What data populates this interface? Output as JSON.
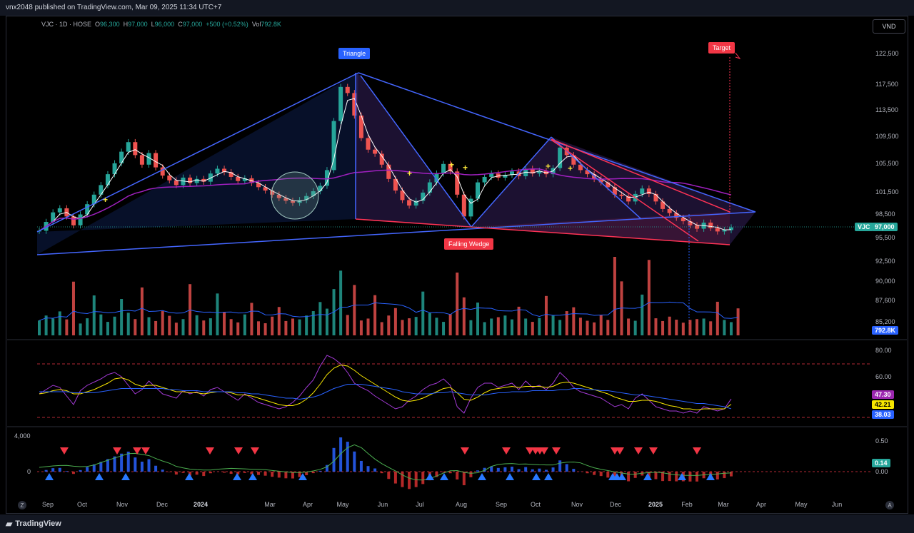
{
  "header": {
    "published": "vnx2048 published on TradingView.com, Mar 09, 2025 11:34 UTC+7"
  },
  "legend": {
    "symbol": "VJC · 1D · HOSE",
    "o_label": "O",
    "o": "96,300",
    "h_label": "H",
    "h": "97,000",
    "l_label": "L",
    "l": "96,000",
    "c_label": "C",
    "c": "97,000",
    "chg": "+500 (+0.52%)",
    "vol_label": "Vol",
    "vol": "792.8K"
  },
  "currency": "VND",
  "footer": {
    "logo": "TradingView"
  },
  "buttons": {
    "z": "Z",
    "a": "A"
  },
  "colors": {
    "up": "#26a69a",
    "down": "#ef5350",
    "pattern": "#4466ff",
    "wedge": "#ff3355",
    "ma": "#a020c0",
    "rsi": "#a33ad6",
    "label_blue": "#2962ff",
    "label_red": "#f23645"
  },
  "chart_data": [
    {
      "type": "candlestick",
      "symbol": "VJC",
      "interval": "1D",
      "exchange": "HOSE",
      "x_ticks": [
        "Sep",
        "Oct",
        "Nov",
        "Dec",
        "2024",
        "Mar",
        "Apr",
        "May",
        "Jun",
        "Jul",
        "Aug",
        "Sep",
        "Oct",
        "Nov",
        "Dec",
        "2025",
        "Feb",
        "Mar",
        "Apr",
        "May",
        "Jun"
      ],
      "y_ticks": [
        "122,500",
        "117,500",
        "113,500",
        "109,500",
        "105,500",
        "101,500",
        "98,500",
        "95,500",
        "92,500",
        "90,000",
        "87,600",
        "85,200"
      ],
      "last_price": "97,000",
      "price_label": "VJC",
      "annotations": [
        "Triangle",
        "Falling Wedge",
        "Target"
      ],
      "close": [
        96500,
        97800,
        99200,
        99800,
        98600,
        97300,
        98900,
        100400,
        101800,
        103200,
        104800,
        106400,
        108100,
        109500,
        107600,
        106200,
        107900,
        105800,
        104600,
        103900,
        103200,
        104300,
        103500,
        104100,
        103700,
        104900,
        105600,
        105100,
        104400,
        103800,
        104200,
        103500,
        102900,
        102400,
        101800,
        101300,
        100900,
        100600,
        101000,
        101600,
        102300,
        103100,
        105400,
        112600,
        117600,
        116700,
        113400,
        110100,
        108400,
        107800,
        106200,
        104100,
        102400,
        101000,
        100200,
        100900,
        102100,
        103600,
        104900,
        106300,
        105200,
        101800,
        98600,
        101200,
        103600,
        104400,
        104900,
        104300,
        104700,
        105200,
        104500,
        105600,
        104900,
        105300,
        104800,
        105700,
        108700,
        107600,
        106200,
        105400,
        104800,
        104100,
        103600,
        102900,
        101800,
        101600,
        100800,
        101900,
        102700,
        101900,
        100800,
        99700,
        99100,
        98400,
        97900,
        97300,
        96800,
        97700,
        96900,
        96400,
        96600,
        97000
      ],
      "volume_k": [
        540,
        720,
        610,
        870,
        580,
        1950,
        430,
        620,
        1450,
        760,
        490,
        680,
        1320,
        820,
        590,
        1740,
        660,
        520,
        880,
        710,
        460,
        590,
        1860,
        730,
        540,
        620,
        1520,
        840,
        590,
        470,
        760,
        1180,
        510,
        440,
        680,
        1030,
        520,
        610,
        580,
        720,
        880,
        1210,
        970,
        1680,
        2350,
        740,
        1830,
        540,
        610,
        1460,
        480,
        720,
        990,
        560,
        620,
        670,
        1590,
        810,
        640,
        490,
        770,
        2280,
        1380,
        550,
        1190,
        480,
        610,
        660,
        720,
        580,
        1040,
        610,
        490,
        630,
        1430,
        720,
        560,
        880,
        1020,
        640,
        530,
        470,
        740,
        560,
        2850,
        1960,
        610,
        530,
        1480,
        2740,
        620,
        520,
        680,
        570,
        460,
        560,
        590,
        610,
        510,
        1220,
        560,
        480,
        980
      ]
    },
    {
      "type": "line",
      "name": "RSI",
      "y_ticks": [
        "80.00",
        "60.00"
      ],
      "last_values": [
        "47.30",
        "42.21",
        "38.03"
      ],
      "rsi": [
        52,
        56,
        60,
        58,
        50,
        42,
        55,
        60,
        63,
        66,
        70,
        72,
        68,
        60,
        52,
        56,
        64,
        58,
        52,
        50,
        48,
        55,
        52,
        54,
        50,
        56,
        58,
        54,
        50,
        46,
        52,
        48,
        44,
        42,
        40,
        38,
        40,
        44,
        50,
        58,
        65,
        78,
        88,
        85,
        80,
        72,
        62,
        58,
        55,
        50,
        46,
        42,
        38,
        40,
        46,
        50,
        56,
        60,
        62,
        66,
        60,
        40,
        34,
        48,
        58,
        62,
        62,
        58,
        60,
        62,
        56,
        64,
        58,
        60,
        56,
        62,
        72,
        66,
        58,
        54,
        52,
        50,
        48,
        44,
        40,
        42,
        38,
        48,
        52,
        46,
        40,
        38,
        36,
        36,
        34,
        36,
        34,
        40,
        38,
        36,
        38,
        47.3
      ],
      "signal": [
        52,
        53,
        55,
        56,
        55,
        52,
        52,
        54,
        56,
        59,
        62,
        66,
        67,
        65,
        61,
        59,
        60,
        60,
        58,
        56,
        54,
        54,
        53,
        53,
        52,
        53,
        54,
        54,
        53,
        51,
        51,
        50,
        48,
        46,
        44,
        42,
        41,
        41,
        43,
        47,
        53,
        61,
        70,
        76,
        79,
        78,
        74,
        69,
        65,
        61,
        57,
        53,
        49,
        46,
        45,
        46,
        48,
        51,
        54,
        57,
        58,
        53,
        47,
        46,
        49,
        53,
        56,
        57,
        58,
        59,
        58,
        59,
        59,
        59,
        58,
        59,
        62,
        63,
        62,
        60,
        58,
        56,
        54,
        52,
        49,
        47,
        45,
        45,
        46,
        46,
        45,
        43,
        41,
        40,
        38,
        38,
        37,
        38,
        38,
        38,
        38,
        42.21
      ],
      "slow": [
        54,
        54,
        54,
        54,
        54,
        53,
        53,
        53,
        53,
        54,
        55,
        56,
        57,
        57,
        57,
        57,
        57,
        57,
        57,
        56,
        56,
        55,
        55,
        55,
        54,
        54,
        54,
        54,
        54,
        53,
        53,
        52,
        52,
        51,
        50,
        49,
        48,
        48,
        47,
        48,
        49,
        51,
        54,
        57,
        59,
        61,
        61,
        61,
        60,
        59,
        58,
        57,
        56,
        54,
        53,
        52,
        52,
        52,
        53,
        53,
        54,
        53,
        52,
        51,
        51,
        51,
        52,
        53,
        53,
        54,
        54,
        54,
        55,
        55,
        55,
        55,
        56,
        56,
        57,
        57,
        56,
        56,
        55,
        55,
        54,
        53,
        52,
        51,
        51,
        50,
        49,
        48,
        47,
        46,
        45,
        44,
        43,
        43,
        42,
        41,
        40,
        38.03
      ]
    },
    {
      "type": "bar",
      "name": "Oscillator",
      "left_ticks": [
        "4,000",
        "0"
      ],
      "y_ticks": [
        "0.50",
        "0.00"
      ],
      "last_value": "0.14"
    }
  ]
}
